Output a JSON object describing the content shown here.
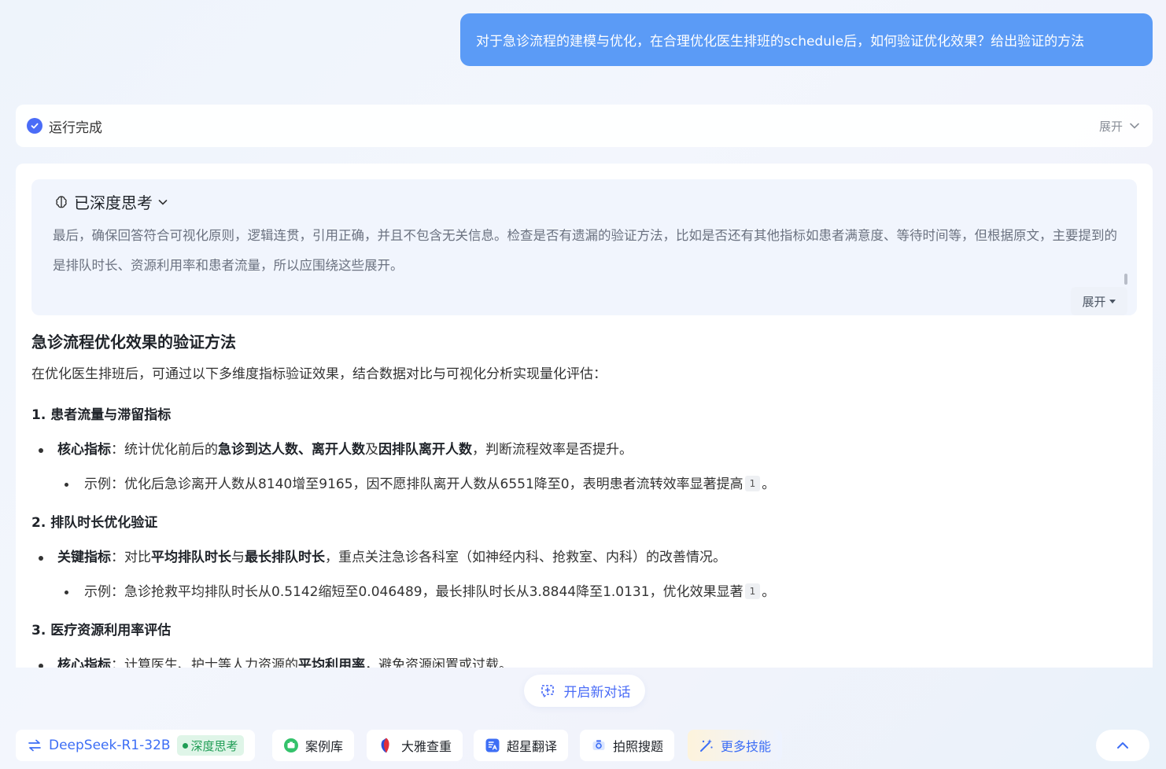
{
  "user_message": "对于急诊流程的建模与优化，在合理优化医生排班的schedule后，如何验证优化效果？给出验证的方法",
  "status": {
    "label": "运行完成",
    "expand_label": "展开"
  },
  "thinking": {
    "title": "已深度思考",
    "text": "最后，确保回答符合可视化原则，逻辑连贯，引用正确，并且不包含无关信息。检查是否有遗漏的验证方法，比如是否还有其他指标如患者满意度、等待时间等，但根据原文，主要提到的是排队时长、资源利用率和患者流量，所以应围绕这些展开。",
    "expand_label": "展开"
  },
  "answer": {
    "title": "急诊流程优化效果的验证方法",
    "intro": "在优化医生排班后，可通过以下多维度指标验证效果，结合数据对比与可视化分析实现量化评估：",
    "sections": [
      {
        "heading": "1. 患者流量与滞留指标",
        "bullet": {
          "label": "核心指标",
          "sep": "：",
          "t1": "统计优化前后的",
          "b1": "急诊到达人数、离开人数",
          "t2": "及",
          "b2": "因排队离开人数",
          "t3": "，判断流程效率是否提升。"
        },
        "example": {
          "text": "示例：优化后急诊离开人数从8140增至9165，因不愿排队离开人数从6551降至0，表明患者流转效率显著提高",
          "cite": "1",
          "end": "。"
        }
      },
      {
        "heading": "2. 排队时长优化验证",
        "bullet": {
          "label": "关键指标",
          "sep": "：",
          "t1": "对比",
          "b1": "平均排队时长",
          "t2": "与",
          "b2": "最长排队时长",
          "t3": "，重点关注急诊各科室（如神经内科、抢救室、内科）的改善情况。"
        },
        "example": {
          "text": "示例：急诊抢救平均排队时长从0.5142缩短至0.046489，最长排队时长从3.8844降至1.0131，优化效果显著",
          "cite": "1",
          "end": "。"
        }
      },
      {
        "heading": "3. 医疗资源利用率评估",
        "bullet": {
          "label": "核心指标",
          "sep": "：",
          "t1": "计算医生、护士等人力资源的",
          "b1": "平均利用率",
          "t2": "，避免资源闲置或过载。"
        }
      }
    ]
  },
  "new_chat_label": "开启新对话",
  "bottom": {
    "model_name": "DeepSeek-R1-32B",
    "deep_think_badge": "深度思考",
    "skills": [
      {
        "label": "案例库",
        "icon": "case-library-icon"
      },
      {
        "label": "大雅查重",
        "icon": "plagiarism-check-icon"
      },
      {
        "label": "超星翻译",
        "icon": "translate-icon"
      },
      {
        "label": "拍照搜题",
        "icon": "camera-search-icon"
      },
      {
        "label": "更多技能",
        "icon": "magic-wand-icon"
      }
    ]
  },
  "colors": {
    "accent": "#4a6cf7",
    "user_bubble": "#5b9bf6",
    "badge_green": "#1f9d55"
  }
}
